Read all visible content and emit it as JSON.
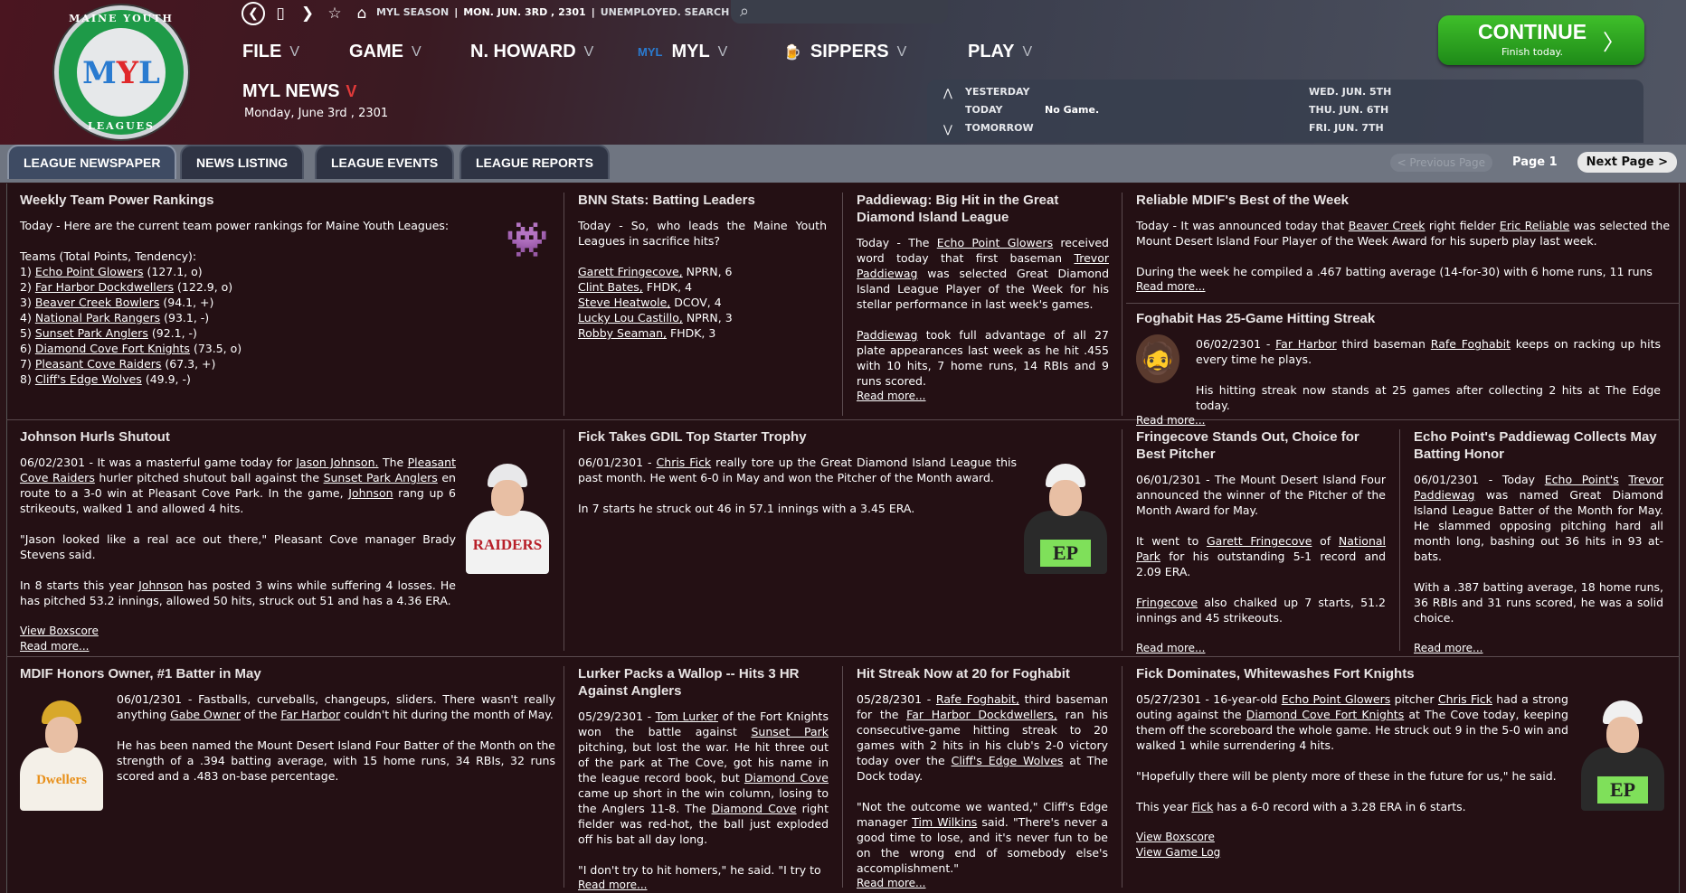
{
  "topbar": {
    "back_icon": "back-circle-icon",
    "info": [
      "MYL SEASON",
      "MON. JUN. 3RD , 2301",
      "UNEMPLOYED. SEARCH JOBS..."
    ],
    "search_placeholder": ""
  },
  "menu": [
    "FILE",
    "GAME",
    "N. HOWARD",
    "MYL",
    "SIPPERS",
    "PLAY"
  ],
  "logo": {
    "letters": [
      "M",
      "Y",
      "L"
    ],
    "ring_top": "MAINE YOUTH",
    "ring_bottom": "LEAGUES"
  },
  "news": {
    "title": "MYL NEWS",
    "date": "Monday, June 3rd , 2301"
  },
  "continue": {
    "label": "CONTINUE",
    "sub": "Finish today."
  },
  "schedule": {
    "rows": [
      {
        "label": "YESTERDAY",
        "value": "",
        "right": "WED. JUN. 5TH"
      },
      {
        "label": "TODAY",
        "value": "No Game.",
        "right": "THU. JUN. 6TH"
      },
      {
        "label": "TOMORROW",
        "value": "",
        "right": "FRI. JUN. 7TH"
      }
    ]
  },
  "tabs": [
    "LEAGUE NEWSPAPER",
    "NEWS LISTING",
    "LEAGUE EVENTS",
    "LEAGUE REPORTS"
  ],
  "pager": {
    "prev": "< Previous Page",
    "page": "Page 1",
    "next": "Next Page >"
  },
  "colors": {
    "accent_green": "#2eaa22",
    "header_red": "#4a1520",
    "paper_bg": "#241014"
  },
  "stories": {
    "power": {
      "title": "Weekly Team Power Rankings",
      "intro": "Today - Here are the current team power rankings for Maine Youth Leagues:",
      "sub": "Teams (Total Points, Tendency):",
      "rows": [
        {
          "n": "1)",
          "team": "Echo Point Glowers",
          "stat": "(127.1, o)"
        },
        {
          "n": "2)",
          "team": "Far Harbor Dockdwellers",
          "stat": "(122.9, o)"
        },
        {
          "n": "3)",
          "team": "Beaver Creek Bowlers",
          "stat": "(94.1, +)"
        },
        {
          "n": "4)",
          "team": "National Park Rangers",
          "stat": "(93.1, -)"
        },
        {
          "n": "5)",
          "team": "Sunset Park Anglers",
          "stat": "(92.1, -)"
        },
        {
          "n": "6)",
          "team": "Diamond Cove Fort Knights",
          "stat": "(73.5, o)"
        },
        {
          "n": "7)",
          "team": "Pleasant Cove Raiders",
          "stat": "(67.3, +)"
        },
        {
          "n": "8)",
          "team": "Cliff's Edge Wolves",
          "stat": "(49.9, -)"
        }
      ]
    },
    "bnn": {
      "title": "BNN Stats: Batting Leaders",
      "intro": "Today - So, who leads the Maine Youth Leagues in sacrifice hits?",
      "rows": [
        {
          "name": "Garett Fringecove,",
          "stat": " NPRN, 6"
        },
        {
          "name": "Clint Bates,",
          "stat": " FHDK, 4"
        },
        {
          "name": "Steve Heatwole,",
          "stat": " DCOV, 4"
        },
        {
          "name": "Lucky Lou Castillo,",
          "stat": " NPRN, 3"
        },
        {
          "name": "Robby Seaman,",
          "stat": " FHDK, 3"
        }
      ]
    },
    "paddiewag": {
      "title": "Paddiewag: Big Hit in the Great Diamond Island League",
      "p1_a": "Today - The ",
      "p1_link1": "Echo Point Glowers",
      "p1_b": " received word today that first baseman ",
      "p1_link2": "Trevor Paddiewag",
      "p1_c": " was selected Great Diamond Island League Player of the Week for his stellar performance in last week's games.",
      "p2_link": "Paddiewag",
      "p2_text": " took full advantage of all 27 plate appearances last week as he hit .455 with 10 hits, 7 home runs, 14 RBIs and 9 runs scored.",
      "more": "Read more..."
    },
    "reliable": {
      "title": "Reliable MDIF's Best of the Week",
      "p1_a": "Today - It was announced today that ",
      "p1_link1": "Beaver Creek",
      "p1_b": " right fielder ",
      "p1_link2": "Eric Reliable",
      "p1_c": " was selected the Mount Desert Island Four Player of the Week Award for his superb play last week.",
      "p2": "During the week he compiled a .467 batting average (14-for-30) with 6 home runs, 11 runs",
      "more": "Read more..."
    },
    "foghabit": {
      "title": "Foghabit Has 25-Game Hitting Streak",
      "p1_a": "06/02/2301 - ",
      "p1_link1": "Far Harbor",
      "p1_b": " third baseman ",
      "p1_link2": "Rafe Foghabit",
      "p1_c": " keeps on racking up hits every time he plays.",
      "p2": "His hitting streak now stands at 25 games after collecting 2 hits at The Edge today.",
      "more": "Read more..."
    },
    "johnson": {
      "title": "Johnson Hurls Shutout",
      "p1_a": "06/02/2301 - It was a masterful game today for ",
      "p1_link1": "Jason Johnson.",
      "p1_b": " The ",
      "p1_link2": "Pleasant Cove Raiders",
      "p1_c": " hurler pitched shutout ball against the ",
      "p1_link3": "Sunset Park Anglers",
      "p1_d": " en route to a 3-0 win at Pleasant Cove Park. In the game, ",
      "p1_link4": "Johnson",
      "p1_e": " rang up 6 strikeouts, walked 1 and allowed 4 hits.",
      "p2": "\"Jason looked like a real ace out there,\" Pleasant Cove manager Brady Stevens said.",
      "p3_a": "In 8 starts this year ",
      "p3_link": "Johnson",
      "p3_b": " has posted 3 wins while suffering 4 losses. He has pitched 53.2 innings, allowed 50 hits, struck out 51 and has a 4.36 ERA.",
      "box": "View Boxscore",
      "more": "Read more...",
      "jersey": "RAIDERS"
    },
    "fick": {
      "title": "Fick Takes GDIL Top Starter Trophy",
      "p1_a": "06/01/2301 - ",
      "p1_link": "Chris Fick",
      "p1_b": " really tore up the Great Diamond Island League this past month. He went 6-0 in May and won the Pitcher of the Month award.",
      "p2": "In 7 starts he struck out 46 in 57.1 innings with a 3.45 ERA.",
      "jersey": "EP"
    },
    "fringecove": {
      "title": "Fringecove Stands Out, Choice for Best Pitcher",
      "p1": "06/01/2301 - The Mount Desert Island Four announced the winner of the Pitcher of the Month Award for May.",
      "p2_a": "It went to ",
      "p2_link1": "Garett Fringecove",
      "p2_b": " of ",
      "p2_link2": "National Park",
      "p2_c": " for his outstanding 5-1 record and 2.09 ERA.",
      "p3_link": "Fringecove",
      "p3_b": " also chalked up 7 starts, 51.2 innings and 45 strikeouts.",
      "more": "Read more..."
    },
    "echo": {
      "title": "Echo Point's Paddiewag Collects May Batting Honor",
      "p1_a": "06/01/2301 - Today ",
      "p1_link1": "Echo Point's",
      "p1_link2": "Trevor Paddiewag",
      "p1_b": " was named Great Diamond Island League Batter of the Month for May. He slammed opposing pitching hard all month long, bashing out 36 hits in 93 at-bats.",
      "p2": "With a .387 batting average, 18 home runs, 36 RBIs and 31 runs scored, he was a solid choice.",
      "more": "Read more..."
    },
    "owner": {
      "title": "MDIF Honors Owner, #1 Batter in May",
      "p1_a": "06/01/2301 - Fastballs, curveballs, changeups, sliders. There wasn't really anything ",
      "p1_link1": "Gabe Owner",
      "p1_b": " of the ",
      "p1_link2": "Far Harbor",
      "p1_c": " couldn't hit during the month of May.",
      "p2": "He has been named the Mount Desert Island Four Batter of the Month on the strength of a .394 batting average, with 15 home runs, 34 RBIs, 32 runs scored and a .483 on-base percentage.",
      "jersey": "Dwellers"
    },
    "lurker": {
      "title": "Lurker Packs a Wallop -- Hits 3 HR Against Anglers",
      "p1_a": "05/29/2301 - ",
      "p1_link1": "Tom Lurker",
      "p1_b": " of the Fort Knights won the battle against ",
      "p1_link2": "Sunset Park",
      "p1_c": " pitching, but lost the war. He hit three out of the park at The Cove, got his name in the league record book, but ",
      "p1_link3": "Diamond Cove",
      "p1_d": " came up short in the win column, losing to the Anglers 11-8. The ",
      "p1_link4": "Diamond Cove",
      "p1_e": " right fielder was red-hot, the ball just exploded off his bat all day long.",
      "p2": "\"I don't try to hit homers,\" he said. \"I try to",
      "more": "Read more..."
    },
    "streak": {
      "title": "Hit Streak Now at 20 for Foghabit",
      "p1_a": "05/28/2301 - ",
      "p1_link1": "Rafe Foghabit,",
      "p1_b": " third baseman for the ",
      "p1_link2": "Far Harbor Dockdwellers,",
      "p1_c": " ran his consecutive-game hitting streak to 20 games with 2 hits in his club's 2-0 victory today over the ",
      "p1_link3": "Cliff's Edge Wolves",
      "p1_d": " at The Dock today.",
      "p2_a": "\"Not the outcome we wanted,\" Cliff's Edge manager ",
      "p2_link": "Tim Wilkins",
      "p2_b": " said. \"There's never a good time to lose, and it's never fun to be on the wrong end of somebody else's accomplishment.\"",
      "more": "Read more..."
    },
    "fickdom": {
      "title": "Fick Dominates, Whitewashes Fort Knights",
      "p1_a": "05/27/2301 - 16-year-old ",
      "p1_link1": "Echo Point Glowers",
      "p1_b": " pitcher ",
      "p1_link2": "Chris Fick",
      "p1_c": " had a strong outing against the ",
      "p1_link3": "Diamond Cove Fort Knights",
      "p1_d": " at The Cove today, keeping them off the scoreboard the whole game. He struck out 9 in the 5-0 win and walked 1 while surrendering 4 hits.",
      "p2": "\"Hopefully there will be plenty more of these in the future for us,\" he said.",
      "p3_a": "This year ",
      "p3_link": "Fick",
      "p3_b": " has a 6-0 record with a 3.28 ERA in 6 starts.",
      "box": "View Boxscore",
      "log": "View Game Log",
      "jersey": "EP"
    }
  }
}
